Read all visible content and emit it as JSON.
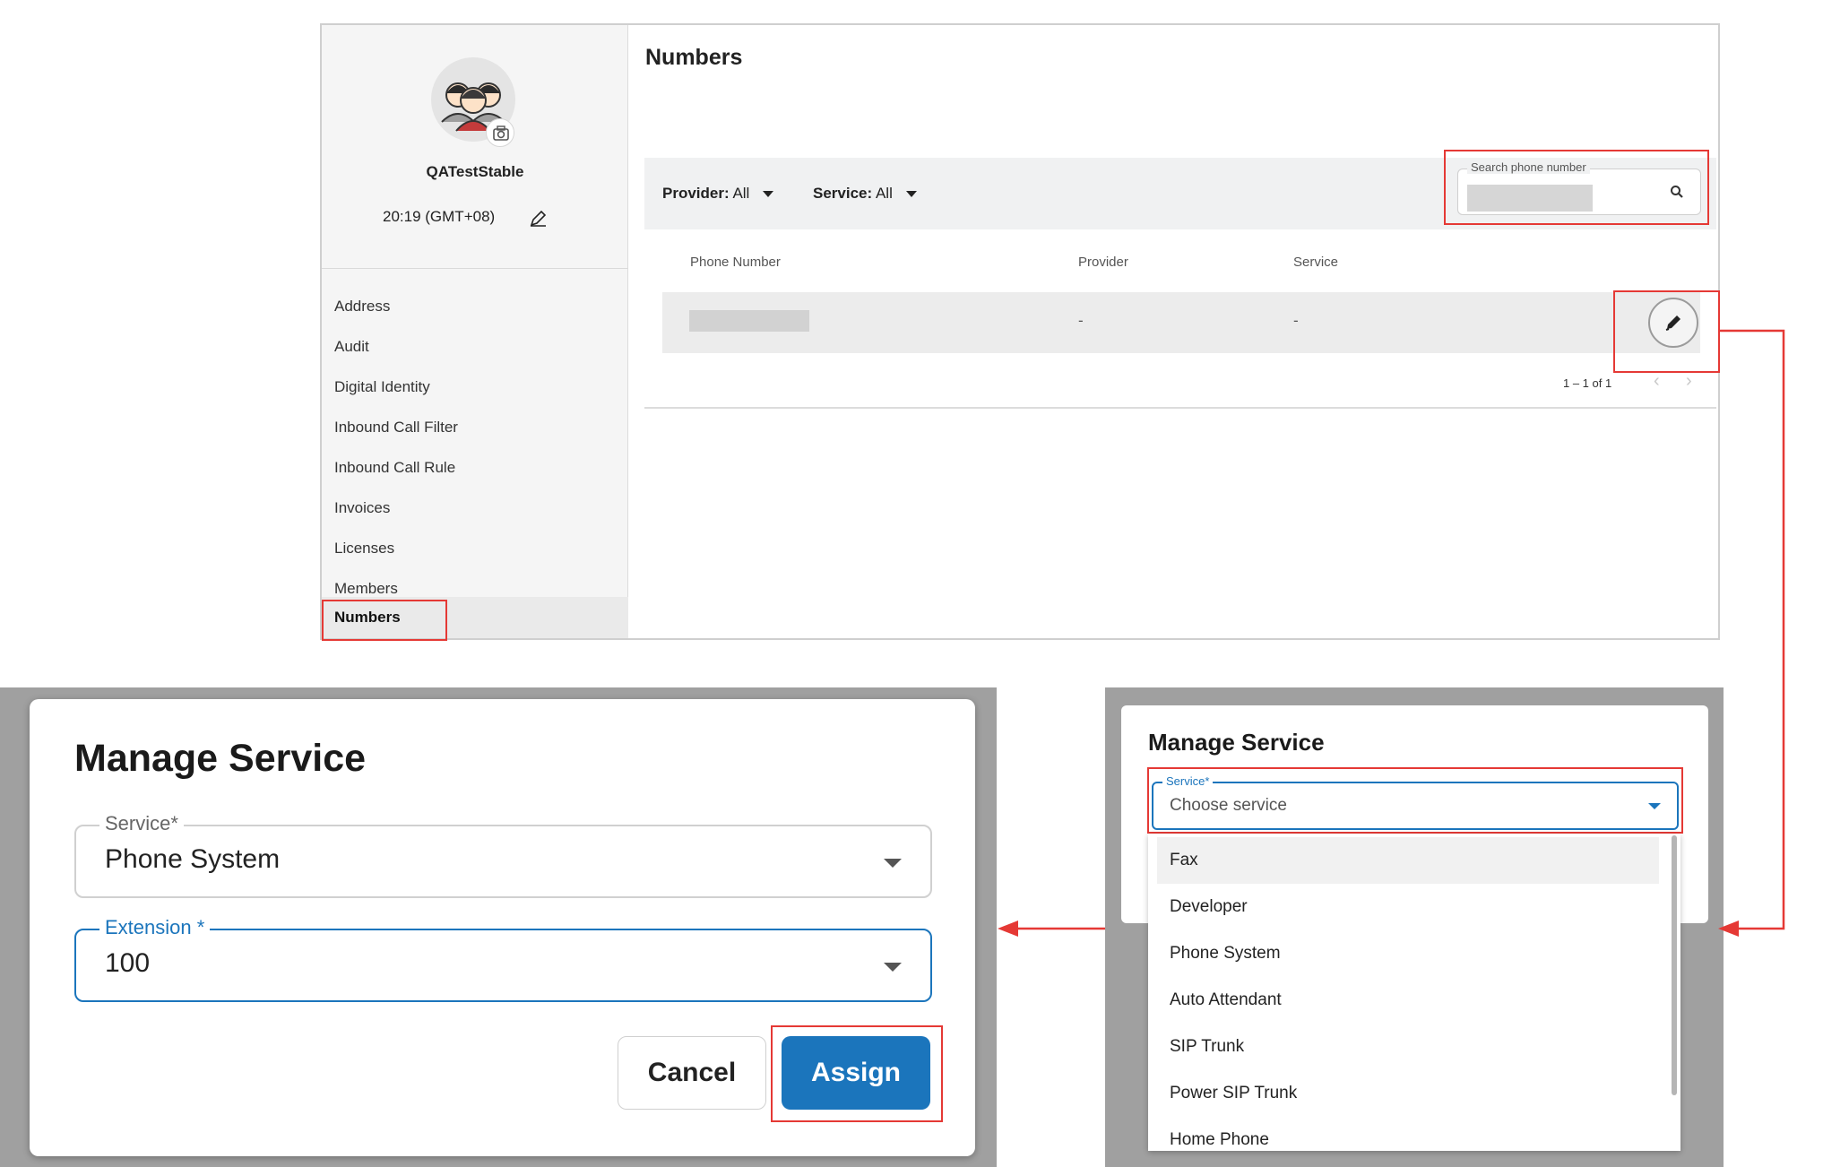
{
  "profile": {
    "org_name": "QATestStable",
    "time": "20:19 (GMT+08)"
  },
  "nav": {
    "items": [
      {
        "label": "Address"
      },
      {
        "label": "Audit"
      },
      {
        "label": "Digital Identity"
      },
      {
        "label": "Inbound Call Filter"
      },
      {
        "label": "Inbound Call Rule"
      },
      {
        "label": "Invoices"
      },
      {
        "label": "Licenses"
      },
      {
        "label": "Members"
      },
      {
        "label": "Numbers",
        "active": true
      }
    ]
  },
  "numbers": {
    "title": "Numbers",
    "filters": {
      "provider_label": "Provider:",
      "provider_value": "All",
      "service_label": "Service:",
      "service_value": "All"
    },
    "search": {
      "label": "Search phone number"
    },
    "columns": [
      "Phone Number",
      "Provider",
      "Service"
    ],
    "rows": [
      {
        "provider": "-",
        "service": "-"
      }
    ],
    "pagination": "1 – 1 of 1"
  },
  "dialog_assign": {
    "title": "Manage Service",
    "service_label": "Service*",
    "service_value": "Phone System",
    "extension_label": "Extension *",
    "extension_value": "100",
    "cancel_label": "Cancel",
    "assign_label": "Assign",
    "accent_color": "#1b75bc"
  },
  "dialog_choose": {
    "title": "Manage Service",
    "service_label": "Service*",
    "service_placeholder": "Choose service",
    "options": [
      "Fax",
      "Developer",
      "Phone System",
      "Auto Attendant",
      "SIP Trunk",
      "Power SIP Trunk",
      "Home Phone"
    ]
  },
  "annotation_color": "#e53935"
}
